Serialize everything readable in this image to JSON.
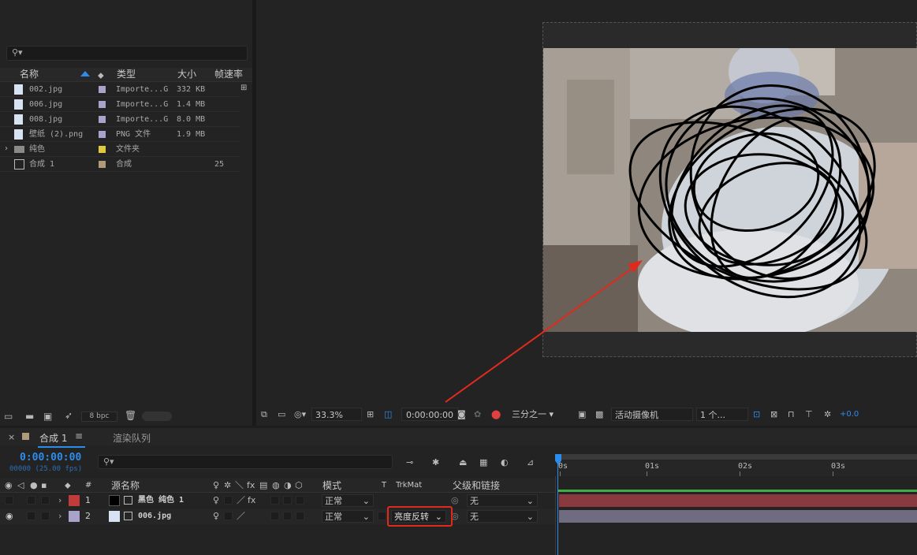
{
  "project": {
    "search_placeholder": "",
    "columns": {
      "name": "名称",
      "type": "类型",
      "size": "大小",
      "fps": "帧速率"
    },
    "items": [
      {
        "name": "002.jpg",
        "type": "Importe...G",
        "size": "332 KB",
        "fps": "",
        "color": "#a9a3cc",
        "kind": "image"
      },
      {
        "name": "006.jpg",
        "type": "Importe...G",
        "size": "1.4 MB",
        "fps": "",
        "color": "#a9a3cc",
        "kind": "image"
      },
      {
        "name": "008.jpg",
        "type": "Importe...G",
        "size": "8.0 MB",
        "fps": "",
        "color": "#a9a3cc",
        "kind": "image"
      },
      {
        "name": "壁纸 (2).png",
        "type": "PNG 文件",
        "size": "1.9 MB",
        "fps": "",
        "color": "#a9a3cc",
        "kind": "image"
      },
      {
        "name": "纯色",
        "type": "文件夹",
        "size": "",
        "fps": "",
        "color": "#e2c83c",
        "kind": "folder"
      },
      {
        "name": "合成 1",
        "type": "合成",
        "size": "",
        "fps": "25",
        "color": "#b09a7a",
        "kind": "comp"
      }
    ],
    "bpc": "8 bpc"
  },
  "viewer": {
    "zoom": "33.3%",
    "timecode": "0:00:00:00",
    "resolution": "三分之一",
    "camera": "活动摄像机",
    "views": "1 个...",
    "exposure": "+0.0"
  },
  "timeline": {
    "tab_comp": "合成 1",
    "tab_render": "渲染队列",
    "timecode": "0:00:00:00",
    "frame_info": "00000 (25.00 fps)",
    "search_placeholder": "",
    "ruler": [
      "0s",
      "01s",
      "02s",
      "03s"
    ],
    "columns": {
      "num": "#",
      "source": "源名称",
      "mode": "模式",
      "t": "T",
      "trkmat": "TrkMat",
      "parent": "父级和链接"
    },
    "layers": [
      {
        "num": "1",
        "name": "黑色 纯色 1",
        "mode": "正常",
        "trkmat": "",
        "parent": "无",
        "label_color": "#c23b3b",
        "bar_color": "#8a3a3e"
      },
      {
        "num": "2",
        "name": "006.jpg",
        "mode": "正常",
        "trkmat": "亮度反转",
        "parent": "无",
        "label_color": "#a9a3cc",
        "bar_color": "#6f6b80"
      }
    ]
  },
  "colors": {
    "accent": "#2d8ceb",
    "highlight_red": "#e02a1e"
  }
}
